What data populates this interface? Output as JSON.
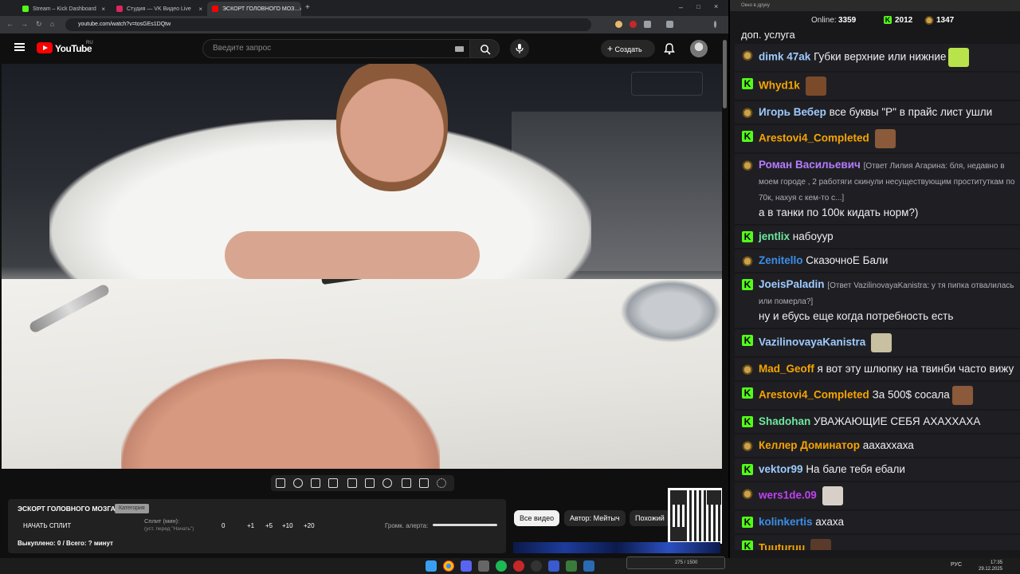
{
  "browser": {
    "tabs": [
      {
        "label": "Stream – Kick Dashboard",
        "color": "#53fc18"
      },
      {
        "label": "Студия — VK Видео Live",
        "color": "#e0245e"
      },
      {
        "label": "ЭСКОРТ ГОЛОВНОГО МОЗ...",
        "color": "#ff0000"
      }
    ],
    "url": "youtube.com/watch?v=tosGEs1DQtw"
  },
  "youtube": {
    "logo_text": "YouTube",
    "region": "RU",
    "search_placeholder": "Введите запрос",
    "create_label": "Создать"
  },
  "panel": {
    "title": "ЭСКОРТ ГОЛОВНОГО МОЗГА",
    "badge": "Категория",
    "start_split": "НАЧАТЬ СПЛИТ",
    "split_label": "Сплит (мин):",
    "split_hint": "(уст. перед \"Начать\")",
    "split_value": "0",
    "increments": [
      "+1",
      "+5",
      "+10",
      "+20"
    ],
    "alert_volume_label": "Громк. алерта:",
    "bought": "Выкуплено: 0 / Всего: ? минут"
  },
  "chips": [
    "Все видео",
    "Автор: Мейтыч",
    "Похожий"
  ],
  "chat": {
    "window_title": "Окно в друку",
    "online_label": "Online:",
    "online_count": "3359",
    "kick_count": "2012",
    "vk_count": "1347",
    "top_text": "доп. услуга",
    "messages": [
      {
        "platform": "vk",
        "name": "dimk 47ak",
        "color": "#9ecbff",
        "text": "Губки верхние или нижние",
        "emote": "#b9e34a"
      },
      {
        "platform": "kick",
        "name": "Whyd1k",
        "color": "#f7a400",
        "text": "",
        "emote": "#7a4a2a"
      },
      {
        "platform": "vk",
        "name": "Игорь Вебер",
        "color": "#9ecbff",
        "text": "все буквы \"Р\" в прайс лист ушли"
      },
      {
        "platform": "kick",
        "name": "Arestovi4_Completed",
        "color": "#f7a400",
        "text": "",
        "emote": "#8a5a3a"
      },
      {
        "platform": "vk",
        "name": "Роман Васильевич",
        "color": "#b57cff",
        "reply": "[Ответ Лилия Агарина: бля, недавно в моем городе , 2 работяги скинули несуществующим проституткам по 70к, нахуя с кем-то с...]",
        "text": "а в танки по 100к кидать норм?)"
      },
      {
        "platform": "kick",
        "name": "jentlix",
        "color": "#6ee7a0",
        "text": "набоуур"
      },
      {
        "platform": "vk",
        "name": "Zenitello",
        "color": "#3b8ee8",
        "text": "СказочноЕ Бали"
      },
      {
        "platform": "kick",
        "name": "JoeisPaladin",
        "color": "#9ecbff",
        "reply": "[Ответ VazilinovayaKanistra: у тя пипка отвалилась или померла?]",
        "text": "ну и ебусь еще когда потребность есть"
      },
      {
        "platform": "kick",
        "name": "VazilinovayaKanistra",
        "color": "#9ecbff",
        "text": "",
        "emote": "#c8c0a0"
      },
      {
        "platform": "vk",
        "name": "Mad_Geoff",
        "color": "#f7a400",
        "text": "я вот эту шлюпку на твинби часто вижу"
      },
      {
        "platform": "kick",
        "name": "Arestovi4_Completed",
        "color": "#f7a400",
        "text": "За 500$ сосала",
        "emote": "#8a5a3a"
      },
      {
        "platform": "kick",
        "name": "Shadohan",
        "color": "#6ee7a0",
        "text": "УВАЖАЮЩИЕ СЕБЯ АХАХХАХА"
      },
      {
        "platform": "vk",
        "name": "Келлер Доминатор",
        "color": "#f7a400",
        "text": "аахаххаха"
      },
      {
        "platform": "kick",
        "name": "vektor99",
        "color": "#9ecbff",
        "text": "На бале тебя ебали"
      },
      {
        "platform": "vk",
        "name": "wers1de.09",
        "color": "#c040f0",
        "text": "",
        "emote": "#d8d0c8"
      },
      {
        "platform": "kick",
        "name": "kolinkertis",
        "color": "#3b8ee8",
        "text": "ахаха"
      },
      {
        "platform": "kick",
        "name": "Tuuturuu",
        "color": "#f7a400",
        "text": "",
        "emote": "#5a3a2a"
      }
    ]
  },
  "taskbar": {
    "lang": "РУС",
    "time": "17:35",
    "date": "29.12.2025",
    "banner": "275 / 1500"
  }
}
